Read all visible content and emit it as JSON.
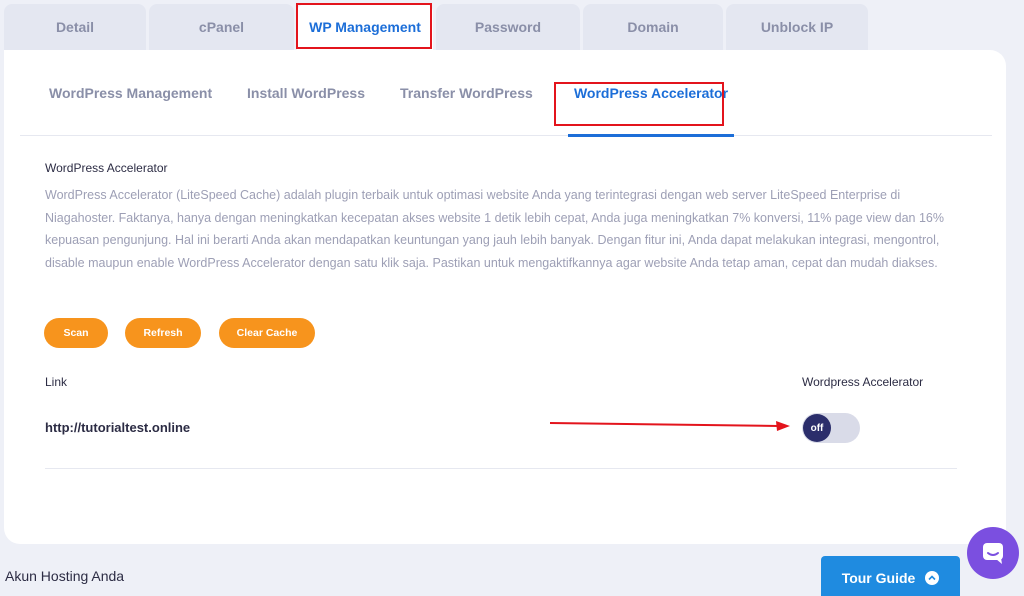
{
  "top_tabs": [
    {
      "label": "Detail"
    },
    {
      "label": "cPanel"
    },
    {
      "label": "WP Management"
    },
    {
      "label": "Password"
    },
    {
      "label": "Domain"
    },
    {
      "label": "Unblock IP"
    }
  ],
  "sub_tabs": [
    {
      "label": "WordPress Management"
    },
    {
      "label": "Install WordPress"
    },
    {
      "label": "Transfer WordPress"
    },
    {
      "label": "WordPress Accelerator"
    }
  ],
  "section": {
    "title": "WordPress Accelerator",
    "description": "WordPress Accelerator (LiteSpeed Cache) adalah plugin terbaik untuk optimasi website Anda yang terintegrasi dengan web server LiteSpeed Enterprise di Niagahoster. Faktanya, hanya dengan meningkatkan kecepatan akses website 1 detik lebih cepat, Anda juga meningkatkan 7% konversi, 11% page view dan 16% kepuasan pengunjung. Hal ini berarti Anda akan mendapatkan keuntungan yang jauh lebih banyak. Dengan fitur ini, Anda dapat melakukan integrasi, mengontrol, disable maupun enable WordPress Accelerator dengan satu klik saja. Pastikan untuk mengaktifkannya agar website Anda tetap aman, cepat dan mudah diakses."
  },
  "actions": {
    "scan": "Scan",
    "refresh": "Refresh",
    "clear_cache": "Clear Cache"
  },
  "table": {
    "col_link": "Link",
    "col_accelerator": "Wordpress Accelerator",
    "rows": [
      {
        "link": "http://tutorialtest.online",
        "toggle_label": "off"
      }
    ]
  },
  "footer": {
    "title": "Akun Hosting Anda",
    "tour_guide": "Tour Guide"
  },
  "colors": {
    "accent": "#1c6ed8",
    "button": "#f7941d",
    "highlight": "#e3141c",
    "chat": "#7b4fe0"
  }
}
